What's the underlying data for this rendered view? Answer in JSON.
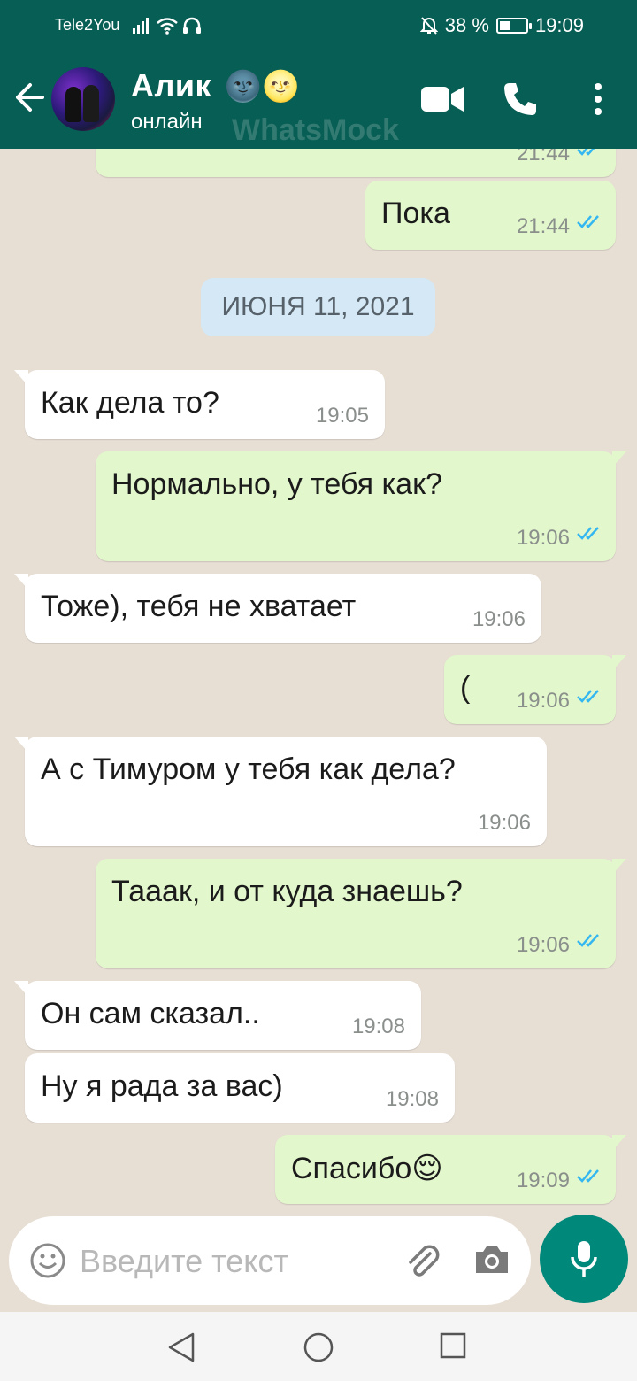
{
  "status_bar": {
    "carrier": "Tele2You",
    "battery": "38 %",
    "battery_level": 0.38,
    "time": "19:09"
  },
  "header": {
    "contact_name": "Алик",
    "contact_emoji": "🌚🌝",
    "status": "онлайн",
    "watermark": "WhatsMock"
  },
  "chat": {
    "date_separator": "ИЮНЯ 11, 2021",
    "messages": [
      {
        "direction": "out",
        "text": "",
        "time": "21:44",
        "read": true
      },
      {
        "direction": "out",
        "text": "Пока",
        "time": "21:44",
        "read": true
      },
      {
        "direction": "in",
        "text": "Как дела то?",
        "time": "19:05"
      },
      {
        "direction": "out",
        "text": "Нормально, у тебя как?",
        "time": "19:06",
        "read": true
      },
      {
        "direction": "in",
        "text": "Тоже), тебя не хватает",
        "time": "19:06"
      },
      {
        "direction": "out",
        "text": "(",
        "time": "19:06",
        "read": true
      },
      {
        "direction": "in",
        "text": "А с Тимуром у тебя как дела?",
        "time": "19:06"
      },
      {
        "direction": "out",
        "text": "Тааак, и от куда знаешь?",
        "time": "19:06",
        "read": true
      },
      {
        "direction": "in",
        "text": "Он сам сказал..",
        "time": "19:08"
      },
      {
        "direction": "in",
        "text": "Ну я рада за вас)",
        "time": "19:08"
      },
      {
        "direction": "out",
        "text": "Спасибо😌",
        "time": "19:09",
        "read": true
      }
    ]
  },
  "composer": {
    "placeholder": "Введите текст"
  },
  "colors": {
    "header": "#075e54",
    "outgoing_bubble": "#e2f7cb",
    "incoming_bubble": "#ffffff",
    "accent": "#00897b",
    "read_ticks": "#34b7f1"
  },
  "icons": [
    "back-arrow-icon",
    "video-call-icon",
    "phone-call-icon",
    "more-options-icon",
    "emoji-icon",
    "attach-icon",
    "camera-icon",
    "mic-icon",
    "nav-back-icon",
    "nav-home-icon",
    "nav-recents-icon"
  ]
}
